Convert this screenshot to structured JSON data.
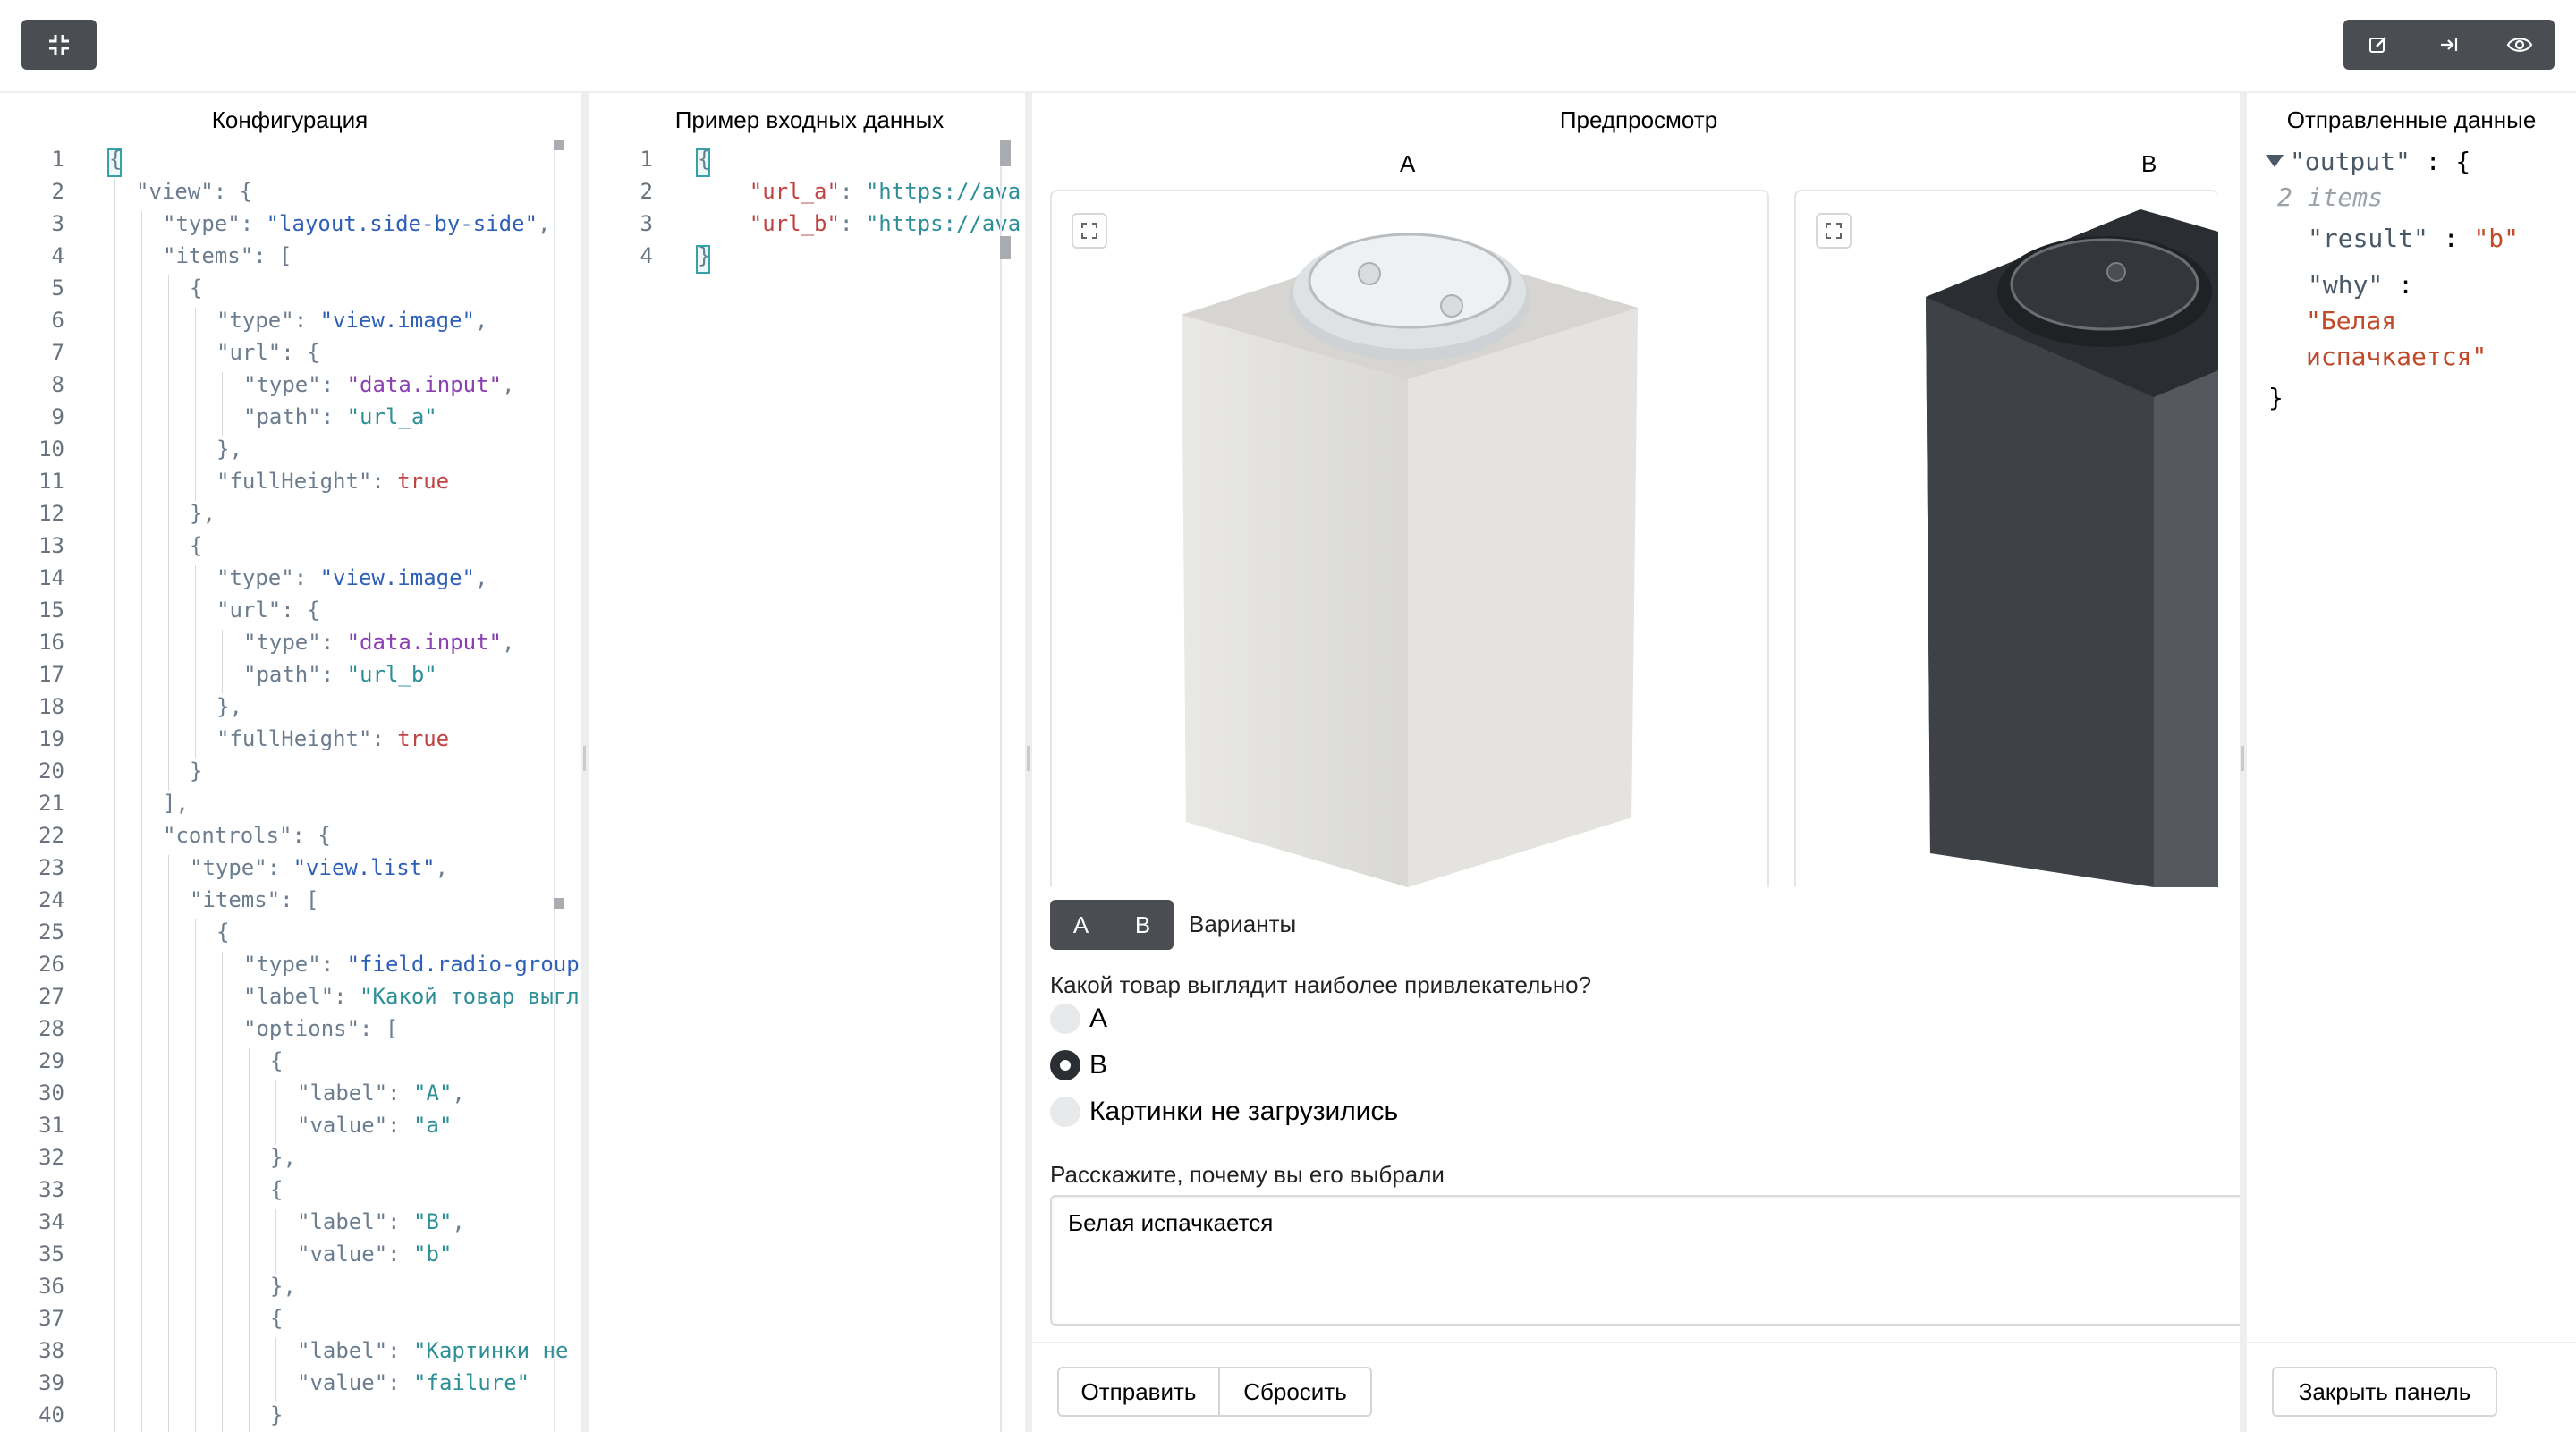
{
  "toolbar": {
    "collapse_icon": "collapse-icon",
    "edit_icon": "edit-icon",
    "collapse_right_icon": "arrow-to-right-icon",
    "preview_icon": "eye-icon"
  },
  "config_panel": {
    "title": "Конфигурация",
    "lines": [
      {
        "n": "1",
        "indent": 0,
        "parts": [
          [
            "k",
            "{"
          ]
        ]
      },
      {
        "n": "2",
        "indent": 1,
        "parts": [
          [
            "k",
            "\"view\": {"
          ]
        ]
      },
      {
        "n": "3",
        "indent": 2,
        "parts": [
          [
            "k",
            "\"type\": "
          ],
          [
            "s",
            "\"layout.side-by-side\""
          ],
          [
            "k",
            ","
          ]
        ]
      },
      {
        "n": "4",
        "indent": 2,
        "parts": [
          [
            "k",
            "\"items\": ["
          ]
        ]
      },
      {
        "n": "5",
        "indent": 3,
        "parts": [
          [
            "k",
            "{"
          ]
        ]
      },
      {
        "n": "6",
        "indent": 4,
        "parts": [
          [
            "k",
            "\"type\": "
          ],
          [
            "s",
            "\"view.image\""
          ],
          [
            "k",
            ","
          ]
        ]
      },
      {
        "n": "7",
        "indent": 4,
        "parts": [
          [
            "k",
            "\"url\": {"
          ]
        ]
      },
      {
        "n": "8",
        "indent": 5,
        "parts": [
          [
            "k",
            "\"type\": "
          ],
          [
            "p",
            "\"data.input\""
          ],
          [
            "k",
            ","
          ]
        ]
      },
      {
        "n": "9",
        "indent": 5,
        "parts": [
          [
            "k",
            "\"path\": "
          ],
          [
            "g",
            "\"url_a\""
          ]
        ]
      },
      {
        "n": "10",
        "indent": 4,
        "parts": [
          [
            "k",
            "},"
          ]
        ]
      },
      {
        "n": "11",
        "indent": 4,
        "parts": [
          [
            "k",
            "\"fullHeight\": "
          ],
          [
            "b",
            "true"
          ]
        ]
      },
      {
        "n": "12",
        "indent": 3,
        "parts": [
          [
            "k",
            "},"
          ]
        ]
      },
      {
        "n": "13",
        "indent": 3,
        "parts": [
          [
            "k",
            "{"
          ]
        ]
      },
      {
        "n": "14",
        "indent": 4,
        "parts": [
          [
            "k",
            "\"type\": "
          ],
          [
            "s",
            "\"view.image\""
          ],
          [
            "k",
            ","
          ]
        ]
      },
      {
        "n": "15",
        "indent": 4,
        "parts": [
          [
            "k",
            "\"url\": {"
          ]
        ]
      },
      {
        "n": "16",
        "indent": 5,
        "parts": [
          [
            "k",
            "\"type\": "
          ],
          [
            "p",
            "\"data.input\""
          ],
          [
            "k",
            ","
          ]
        ]
      },
      {
        "n": "17",
        "indent": 5,
        "parts": [
          [
            "k",
            "\"path\": "
          ],
          [
            "g",
            "\"url_b\""
          ]
        ]
      },
      {
        "n": "18",
        "indent": 4,
        "parts": [
          [
            "k",
            "},"
          ]
        ]
      },
      {
        "n": "19",
        "indent": 4,
        "parts": [
          [
            "k",
            "\"fullHeight\": "
          ],
          [
            "b",
            "true"
          ]
        ]
      },
      {
        "n": "20",
        "indent": 3,
        "parts": [
          [
            "k",
            "}"
          ]
        ]
      },
      {
        "n": "21",
        "indent": 2,
        "parts": [
          [
            "k",
            "],"
          ]
        ]
      },
      {
        "n": "22",
        "indent": 2,
        "parts": [
          [
            "k",
            "\"controls\": {"
          ]
        ]
      },
      {
        "n": "23",
        "indent": 3,
        "parts": [
          [
            "k",
            "\"type\": "
          ],
          [
            "s",
            "\"view.list\""
          ],
          [
            "k",
            ","
          ]
        ]
      },
      {
        "n": "24",
        "indent": 3,
        "parts": [
          [
            "k",
            "\"items\": ["
          ]
        ]
      },
      {
        "n": "25",
        "indent": 4,
        "parts": [
          [
            "k",
            "{"
          ]
        ]
      },
      {
        "n": "26",
        "indent": 5,
        "parts": [
          [
            "k",
            "\"type\": "
          ],
          [
            "s",
            "\"field.radio-group"
          ]
        ]
      },
      {
        "n": "27",
        "indent": 5,
        "parts": [
          [
            "k",
            "\"label\": "
          ],
          [
            "g",
            "\"Какой товар выгл"
          ]
        ]
      },
      {
        "n": "28",
        "indent": 5,
        "parts": [
          [
            "k",
            "\"options\": ["
          ]
        ]
      },
      {
        "n": "29",
        "indent": 6,
        "parts": [
          [
            "k",
            "{"
          ]
        ]
      },
      {
        "n": "30",
        "indent": 7,
        "parts": [
          [
            "k",
            "\"label\": "
          ],
          [
            "g",
            "\"A\""
          ],
          [
            "k",
            ","
          ]
        ]
      },
      {
        "n": "31",
        "indent": 7,
        "parts": [
          [
            "k",
            "\"value\": "
          ],
          [
            "g",
            "\"a\""
          ]
        ]
      },
      {
        "n": "32",
        "indent": 6,
        "parts": [
          [
            "k",
            "},"
          ]
        ]
      },
      {
        "n": "33",
        "indent": 6,
        "parts": [
          [
            "k",
            "{"
          ]
        ]
      },
      {
        "n": "34",
        "indent": 7,
        "parts": [
          [
            "k",
            "\"label\": "
          ],
          [
            "g",
            "\"B\""
          ],
          [
            "k",
            ","
          ]
        ]
      },
      {
        "n": "35",
        "indent": 7,
        "parts": [
          [
            "k",
            "\"value\": "
          ],
          [
            "g",
            "\"b\""
          ]
        ]
      },
      {
        "n": "36",
        "indent": 6,
        "parts": [
          [
            "k",
            "},"
          ]
        ]
      },
      {
        "n": "37",
        "indent": 6,
        "parts": [
          [
            "k",
            "{"
          ]
        ]
      },
      {
        "n": "38",
        "indent": 7,
        "parts": [
          [
            "k",
            "\"label\": "
          ],
          [
            "g",
            "\"Картинки не"
          ]
        ]
      },
      {
        "n": "39",
        "indent": 7,
        "parts": [
          [
            "k",
            "\"value\": "
          ],
          [
            "g",
            "\"failure\""
          ]
        ]
      },
      {
        "n": "40",
        "indent": 6,
        "parts": [
          [
            "k",
            "}"
          ]
        ]
      }
    ]
  },
  "input_panel": {
    "title": "Пример входных данных",
    "lines": [
      {
        "n": "1",
        "parts": [
          [
            "k",
            "{"
          ]
        ]
      },
      {
        "n": "2",
        "parts": [
          [
            "k",
            "    "
          ],
          [
            "b",
            "\"url_a\""
          ],
          [
            "k",
            ": "
          ],
          [
            "g",
            "\"https://ava"
          ]
        ]
      },
      {
        "n": "3",
        "parts": [
          [
            "k",
            "    "
          ],
          [
            "b",
            "\"url_b\""
          ],
          [
            "k",
            ": "
          ],
          [
            "g",
            "\"https://ava"
          ]
        ]
      },
      {
        "n": "4",
        "parts": [
          [
            "k",
            "}"
          ]
        ]
      }
    ]
  },
  "preview_panel": {
    "title": "Предпросмотр",
    "image_a_label": "A",
    "image_b_label": "B",
    "fullscreen_icon": "fullscreen-icon",
    "segment": {
      "option_a": "A",
      "option_b": "B",
      "caption": "Варианты"
    },
    "question": "Какой товар выглядит наиболее привлекательно?",
    "options": [
      {
        "label": "A",
        "checked": false
      },
      {
        "label": "B",
        "checked": true
      },
      {
        "label": "Картинки не загрузились",
        "checked": false
      }
    ],
    "why_label": "Расскажите, почему вы его выбрали",
    "why_value": "Белая испачкается",
    "submit_label": "Отправить",
    "reset_label": "Сбросить"
  },
  "output_panel": {
    "title": "Отправленные данные",
    "root_key": "\"output\"",
    "items_count": "2 items",
    "result_key": "\"result\"",
    "result_value": "\"b\"",
    "why_key": "\"why\"",
    "why_value_line1": "\"Белая",
    "why_value_line2": "испачкается\"",
    "close_label": "Закрыть панель"
  }
}
